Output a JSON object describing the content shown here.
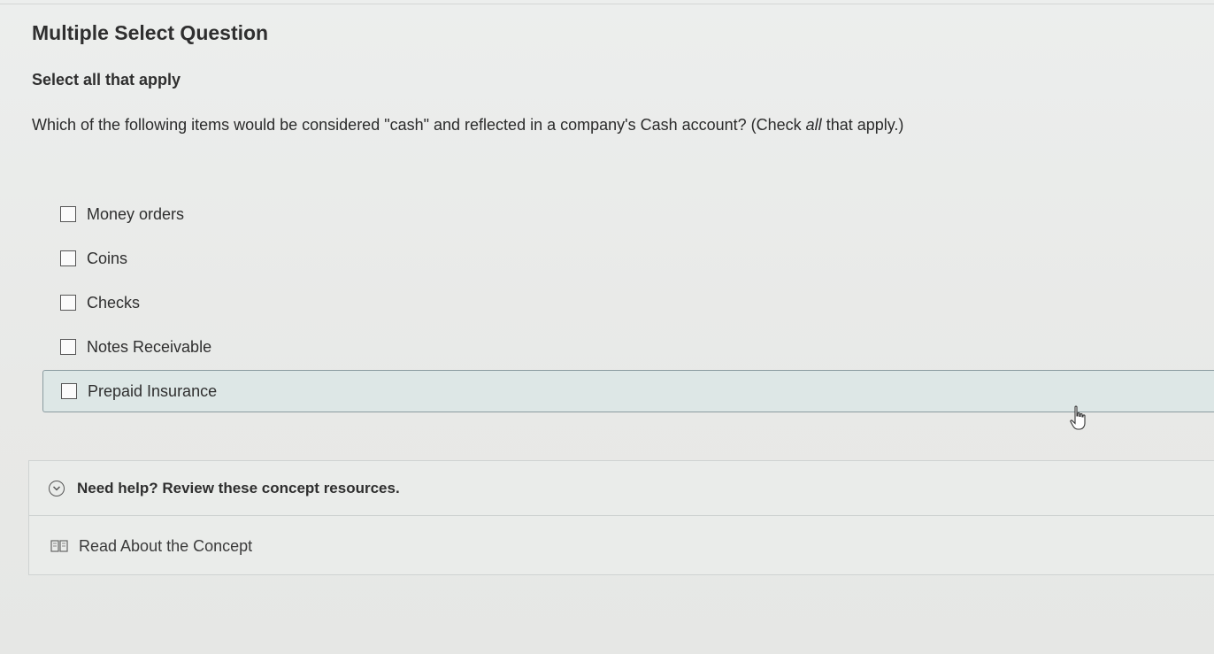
{
  "question": {
    "type_label": "Multiple Select Question",
    "instruction": "Select all that apply",
    "prompt_before": "Which of the following items would be considered \"cash\" and reflected in a company's Cash account? (Check ",
    "prompt_emphasis": "all",
    "prompt_after": " that apply.)"
  },
  "options": [
    {
      "label": "Money orders",
      "checked": false
    },
    {
      "label": "Coins",
      "checked": false
    },
    {
      "label": "Checks",
      "checked": false
    },
    {
      "label": "Notes Receivable",
      "checked": false
    },
    {
      "label": "Prepaid Insurance",
      "checked": false,
      "hovered": true
    }
  ],
  "help": {
    "title": "Need help? Review these concept resources.",
    "link_label": "Read About the Concept",
    "toggle_icon": "chevron-down-circle-icon",
    "link_icon": "book-icon"
  },
  "colors": {
    "hover_bg": "#dde7e6",
    "hover_border": "#8a9ba0"
  }
}
